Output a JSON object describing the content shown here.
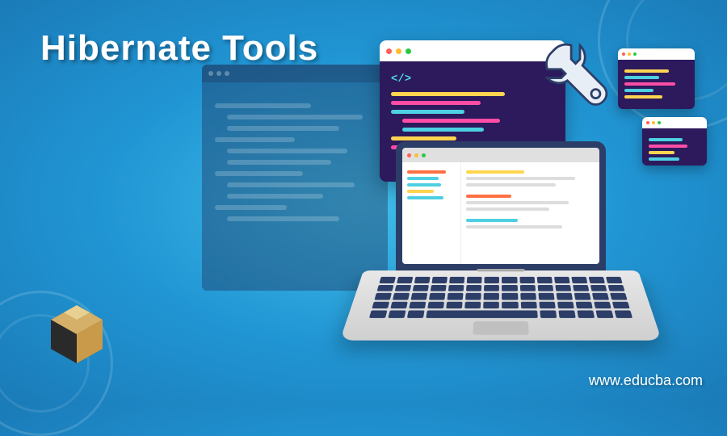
{
  "title": "Hibernate Tools",
  "url": "www.educba.com",
  "editor": {
    "code_tag": "</>"
  },
  "colors": {
    "traffic_red": "#ff5f57",
    "traffic_yellow": "#ffbd2e",
    "traffic_green": "#28c941",
    "editor_bg": "#2c1a5c"
  }
}
